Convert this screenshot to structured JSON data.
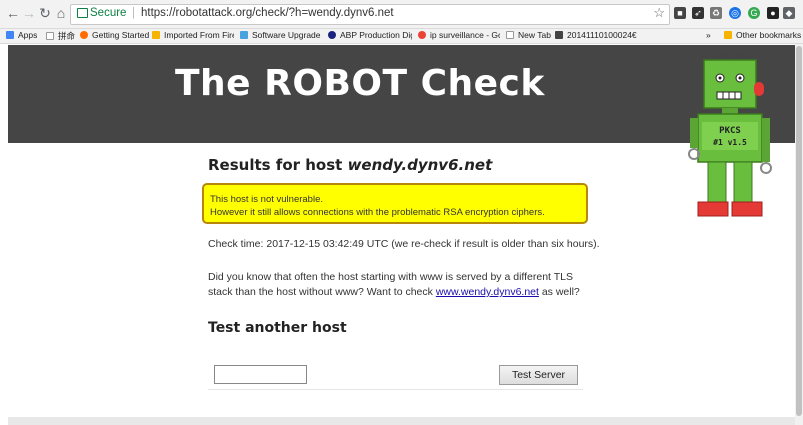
{
  "browser": {
    "secure_label": "Secure",
    "url": "https://robotattack.org/check/?h=wendy.dynv6.net",
    "bookmarks": [
      {
        "label": "Apps",
        "color": "#4285f4"
      },
      {
        "label": "拼命",
        "color": "#999999"
      },
      {
        "label": "Getting Started",
        "color": "#ff6d00"
      },
      {
        "label": "Imported From Fire",
        "color": "#f4b400"
      },
      {
        "label": "Software Upgrade F",
        "color": "#4aa3df"
      },
      {
        "label": "ABP Production Dig",
        "color": "#1a237e"
      },
      {
        "label": "ip surveillance - Goo",
        "color": "#ea4335"
      },
      {
        "label": "New Tab",
        "color": "#999999"
      },
      {
        "label": "20141110100024€",
        "color": "#444444"
      },
      {
        "label": "Other bookmarks",
        "color": "#f4b400"
      }
    ],
    "more_bookmarks": "»"
  },
  "page": {
    "title": "The ROBOT Check",
    "results_prefix": "Results for host ",
    "host": "wendy.dynv6.net",
    "alert_line1": "This host is not vulnerable.",
    "alert_line2": "However it still allows connections with the problematic RSA encryption ciphers.",
    "check_time": "Check time: 2017-12-15 03:42:49 UTC (we re-check if result is older than six hours).",
    "para_text": "Did you know that often the host starting with www is served by a different TLS stack than the host without www? Want to check ",
    "www_link": "www.wendy.dynv6.net",
    "para_suffix": " as well?",
    "test_heading": "Test another host",
    "host_input_value": "",
    "test_button": "Test Server",
    "robot_text1": "PKCS",
    "robot_text2": "#1 v1.5"
  },
  "colors": {
    "banner": "#454545",
    "alert_bg": "#ffff00",
    "alert_border": "#b8860b",
    "robot_green": "#6abe3d",
    "robot_red": "#e53935",
    "secure_green": "#0b8043"
  }
}
